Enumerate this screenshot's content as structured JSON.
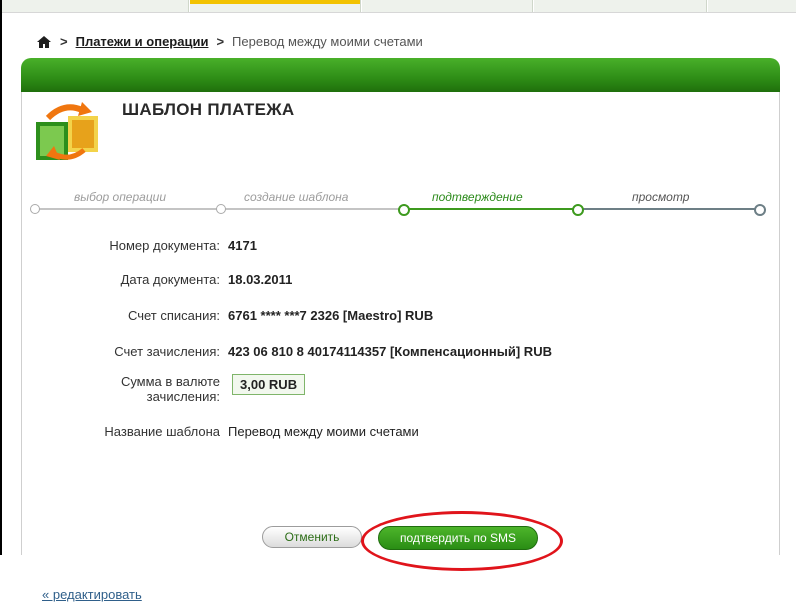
{
  "breadcrumb": {
    "home_icon": "home-icon",
    "separator": ">",
    "link": "Платежи и операции",
    "current": "Перевод между моими счетами"
  },
  "panel": {
    "title": "ШАБЛОН ПЛАТЕЖА",
    "icon": "money-transfer-icon"
  },
  "steps": [
    {
      "label": "выбор операции",
      "state": "done"
    },
    {
      "label": "создание шаблона",
      "state": "done"
    },
    {
      "label": "подтверждение",
      "state": "current"
    },
    {
      "label": "просмотр",
      "state": "future"
    }
  ],
  "form": {
    "doc_number": {
      "label": "Номер документа:",
      "value": "4171"
    },
    "doc_date": {
      "label": "Дата документа:",
      "value": "18.03.2011"
    },
    "debit_account": {
      "label": "Счет списания:",
      "value": "6761 **** ***7 2326  [Maestro]  RUB"
    },
    "credit_account": {
      "label": "Счет зачисления:",
      "value": "423 06 810 8 40174114357  [Компенсационный]  RUB"
    },
    "amount": {
      "label_line1": "Сумма в валюте",
      "label_line2": "зачисления:",
      "value": "3,00  RUB"
    },
    "template_name": {
      "label": "Название шаблона",
      "value": "Перевод между моими счетами"
    }
  },
  "buttons": {
    "cancel": "Отменить",
    "confirm": "подтвердить по SMS"
  },
  "edit_link": "« редактировать",
  "colors": {
    "brand_green": "#2e8d16",
    "highlight_red": "#e0141b",
    "active_tab": "#f2c200"
  }
}
